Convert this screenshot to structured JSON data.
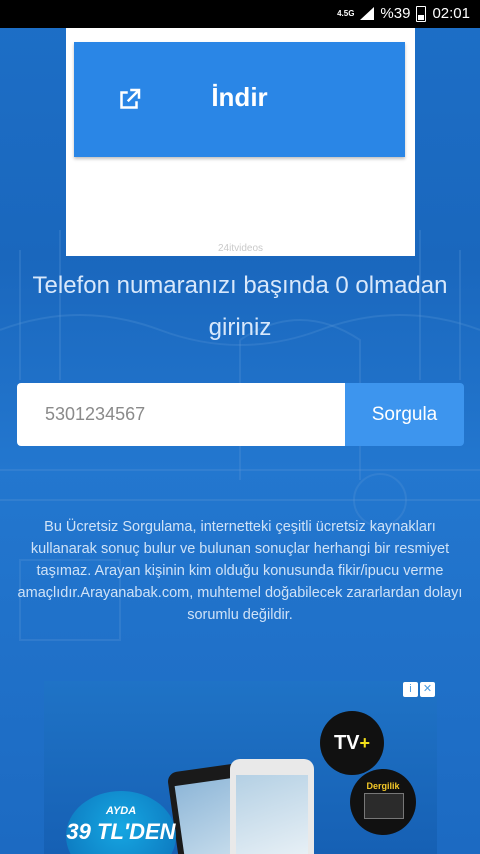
{
  "status_bar": {
    "network": "4.5G",
    "battery_percent": "%39",
    "time": "02:01"
  },
  "top_ad": {
    "download_label": "İndir",
    "brand": "24itvideos"
  },
  "form": {
    "instruction": "Telefon numaranızı başında 0 olmadan giriniz",
    "phone_placeholder": "5301234567",
    "submit_label": "Sorgula"
  },
  "disclaimer": "Bu Ücretsiz Sorgulama, internetteki çeşitli ücretsiz kaynakları kullanarak sonuç bulur ve bulunan sonuçlar herhangi bir resmiyet taşımaz. Arayan kişinin kim olduğu konusunda fikir/ipucu verme amaçlıdır.Arayanabak.com, muhtemel doğabilecek zararlardan dolayı sorumlu değildir.",
  "bottom_ad": {
    "tv_label": "TV",
    "tv_plus": "+",
    "dergilik_label": "Dergilik",
    "price_line1": "AYDA",
    "price_line2": "39 TL'DEN",
    "info_icon": "i",
    "close_icon": "✕"
  },
  "colors": {
    "background": "#1d6fc7",
    "download_button": "#2a86e6",
    "search_button": "#3d95ee"
  }
}
